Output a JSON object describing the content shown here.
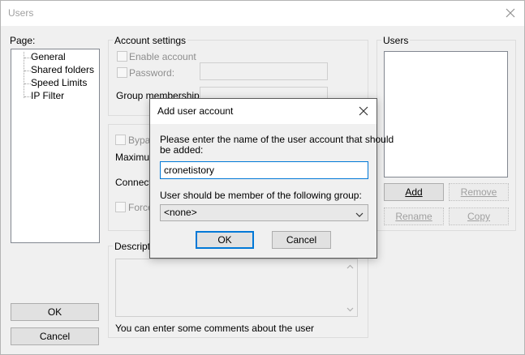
{
  "window": {
    "title": "Users"
  },
  "page_panel": {
    "label": "Page:",
    "items": [
      "General",
      "Shared folders",
      "Speed Limits",
      "IP Filter"
    ]
  },
  "account_settings": {
    "group_label": "Account settings",
    "enable_account": "Enable account",
    "password": "Password:",
    "group_membership": "Group membership:"
  },
  "limits": {
    "bypass": "Bypas",
    "maximum": "Maximum",
    "connection": "Connectio",
    "force": "Force"
  },
  "description": {
    "group_label": "Descriptio",
    "hint": "You can enter some comments about the user"
  },
  "users_panel": {
    "label": "Users",
    "add": "Add",
    "remove": "Remove",
    "rename": "Rename",
    "copy": "Copy"
  },
  "main_buttons": {
    "ok": "OK",
    "cancel": "Cancel"
  },
  "dialog": {
    "title": "Add user account",
    "prompt_line1": "Please enter the name of the user account that should",
    "prompt_line2": "be added:",
    "username_value": "cronetistory",
    "group_prompt": "User should be member of the following group:",
    "group_selected": "<none>",
    "ok": "OK",
    "cancel": "Cancel"
  },
  "colors": {
    "accent": "#0078d7"
  }
}
